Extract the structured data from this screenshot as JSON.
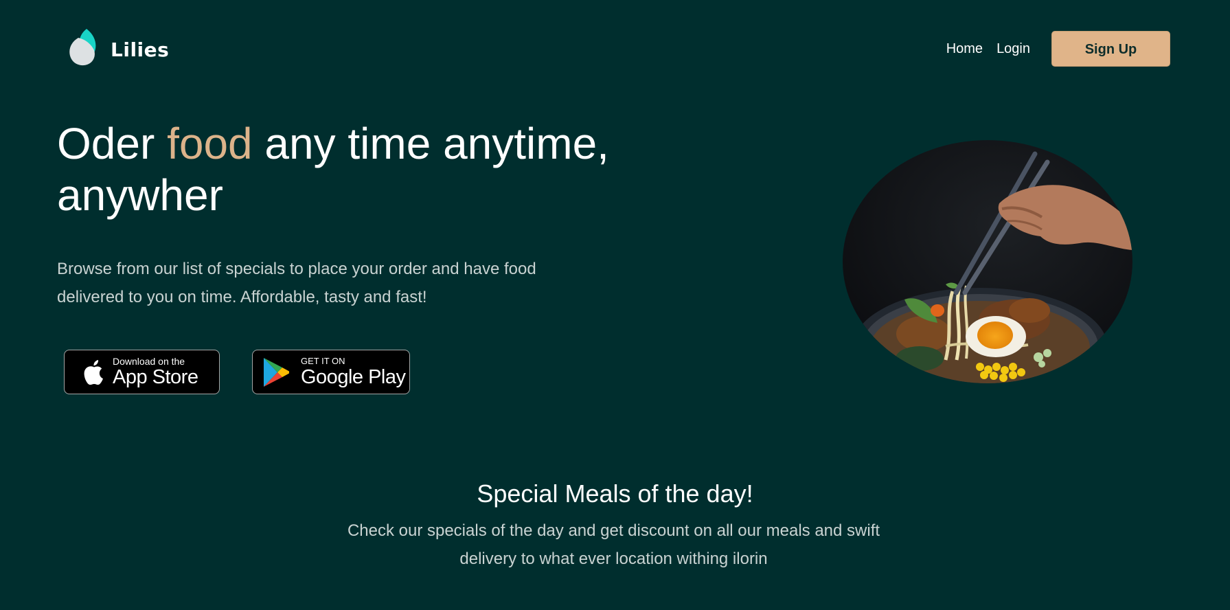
{
  "brand": {
    "name": "Lilies"
  },
  "nav": {
    "links": [
      "Home",
      "Login"
    ],
    "signup_label": "Sign Up"
  },
  "hero": {
    "title_before": "Oder ",
    "title_accent": "food",
    "title_after": " any time anytime, anywher",
    "subtitle": "Browse from our list of specials to place your order and have food delivered to you on time. Affordable, tasty and fast!",
    "image_icon": "food-bowl-image"
  },
  "badges": {
    "apple": {
      "small": "Download on the",
      "big": "App Store",
      "icon": "apple-icon"
    },
    "google": {
      "small": "GET IT ON",
      "big": "Google Play",
      "icon": "google-play-icon"
    }
  },
  "specials": {
    "title": "Special Meals of the day!",
    "subtitle": "Check our specials of the day and get discount on all our meals and swift delivery to what ever location withing ilorin"
  },
  "colors": {
    "background": "#002e2e",
    "accent": "#dcb38a",
    "signup_button": "#e0b489",
    "logo_teal": "#19d4c7"
  }
}
